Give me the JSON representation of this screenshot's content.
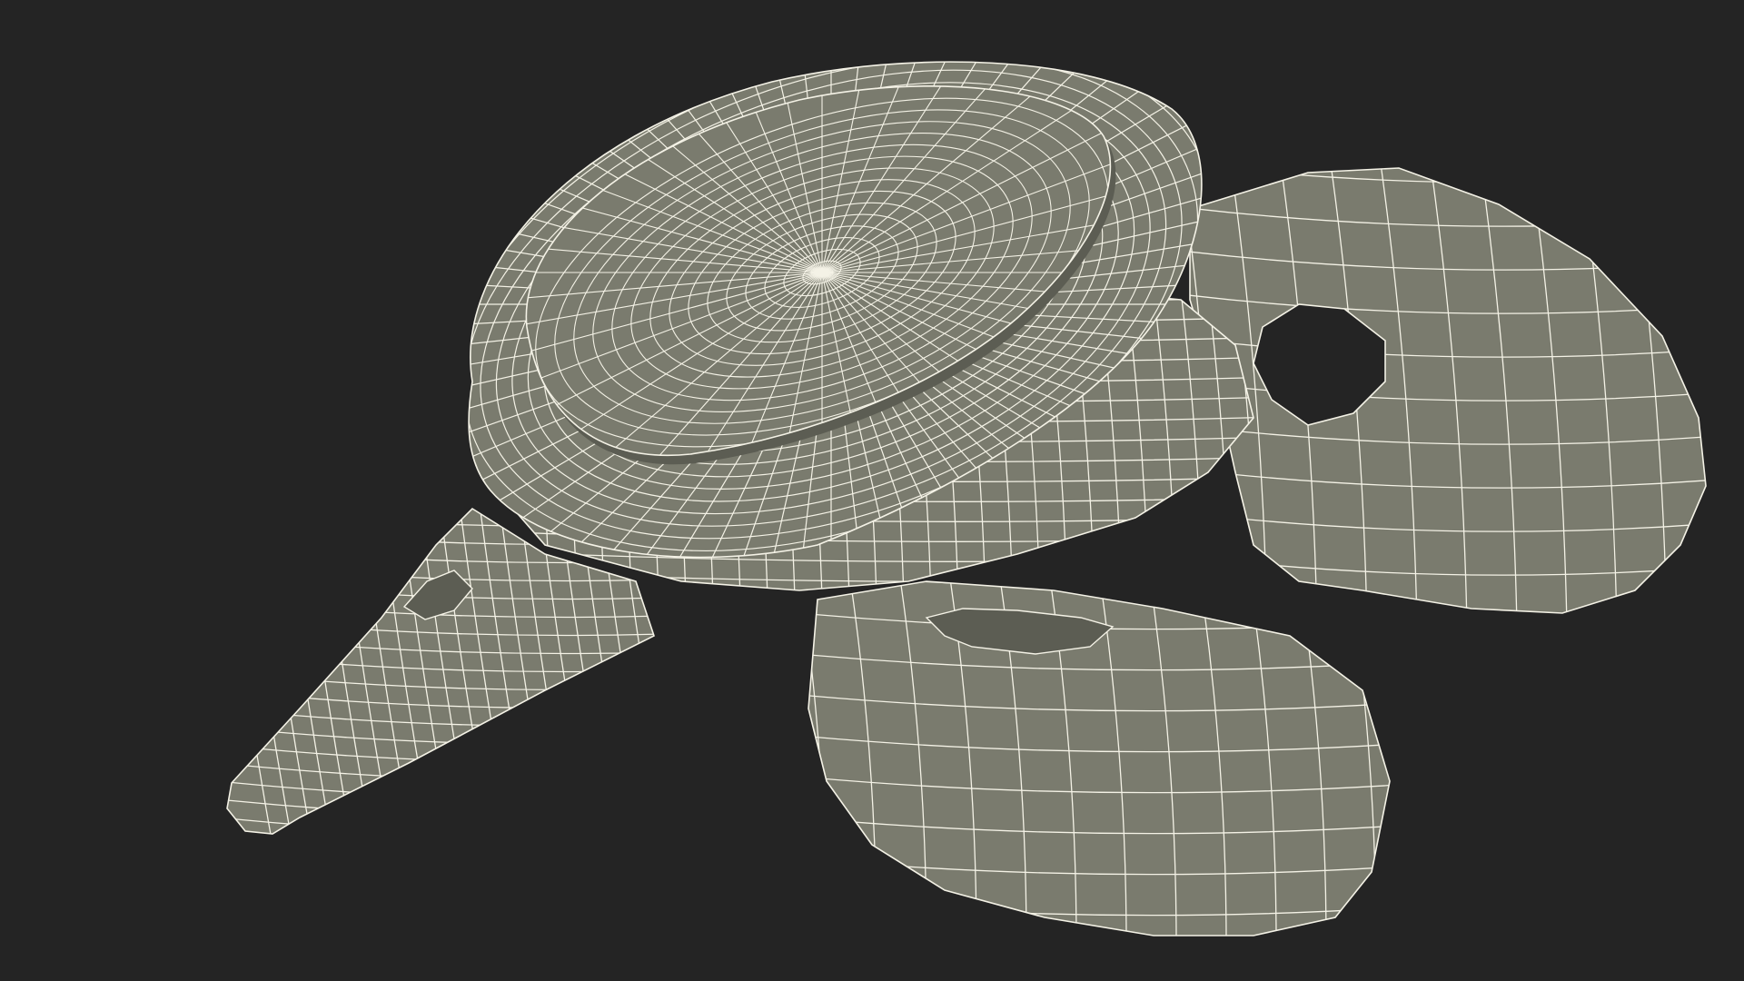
{
  "scene": {
    "background_color": "#242424",
    "mesh_fill_color": "#7a7b6e",
    "mesh_shadow_color": "#5c5d53",
    "wire_color": "#f4f2e6",
    "hole_color": "#242424",
    "render_style": "wireframe-on-shaded",
    "subject": "3d-vertebra-mesh"
  }
}
